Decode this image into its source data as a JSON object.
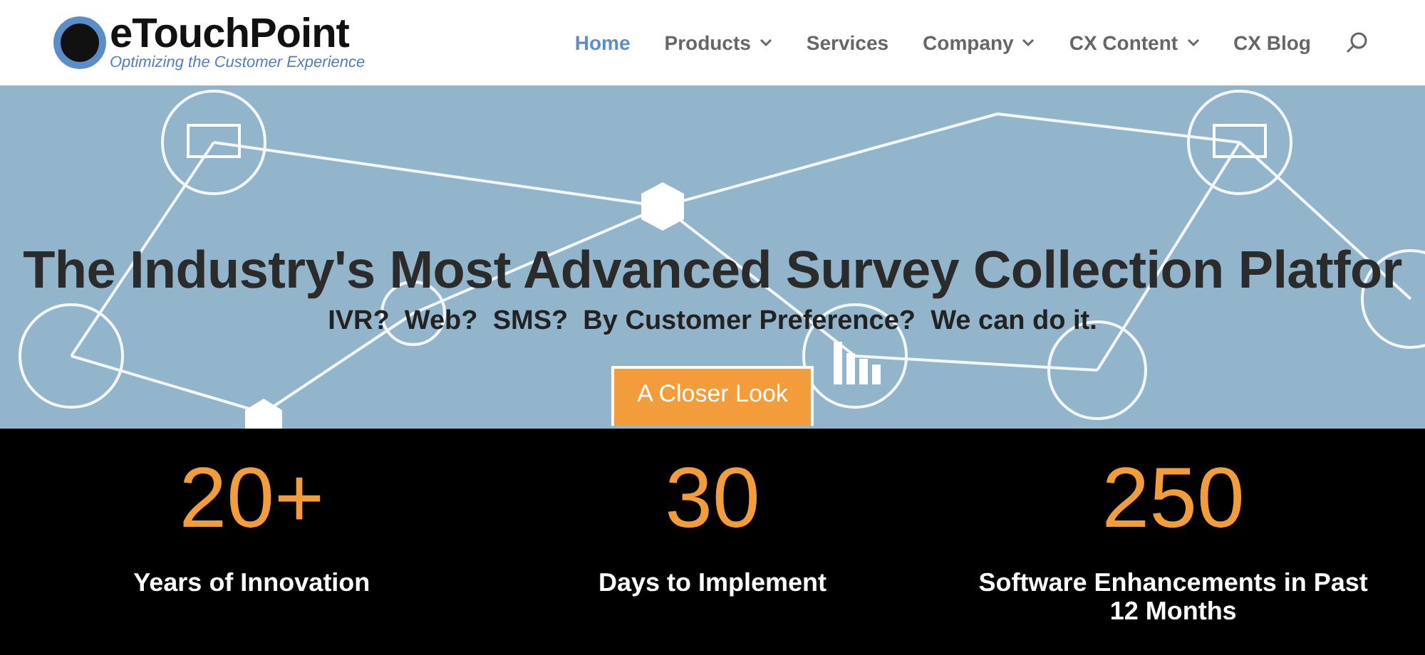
{
  "logo": {
    "name": "eTouchPoint",
    "tagline": "Optimizing the Customer Experience"
  },
  "nav": [
    {
      "label": "Home",
      "selected": true,
      "dropdown": false
    },
    {
      "label": "Products",
      "selected": false,
      "dropdown": true
    },
    {
      "label": "Services",
      "selected": false,
      "dropdown": false
    },
    {
      "label": "Company",
      "selected": false,
      "dropdown": true
    },
    {
      "label": "CX Content",
      "selected": false,
      "dropdown": true
    },
    {
      "label": "CX Blog",
      "selected": false,
      "dropdown": false
    }
  ],
  "hero": {
    "kind": "picture",
    "headline": "The Industry's Most Advanced Survey Collection Platfor",
    "subheadline": "IVR?  Web?  SMS?  By Customer Preference?  We can do it.",
    "button": "A Closer Look"
  },
  "stats": [
    {
      "value": "20+",
      "label": "Years of Innovation"
    },
    {
      "value": "30",
      "label": "Days to Implement"
    },
    {
      "value": "250",
      "label": "Software Enhancements in Past 12 Months"
    }
  ]
}
